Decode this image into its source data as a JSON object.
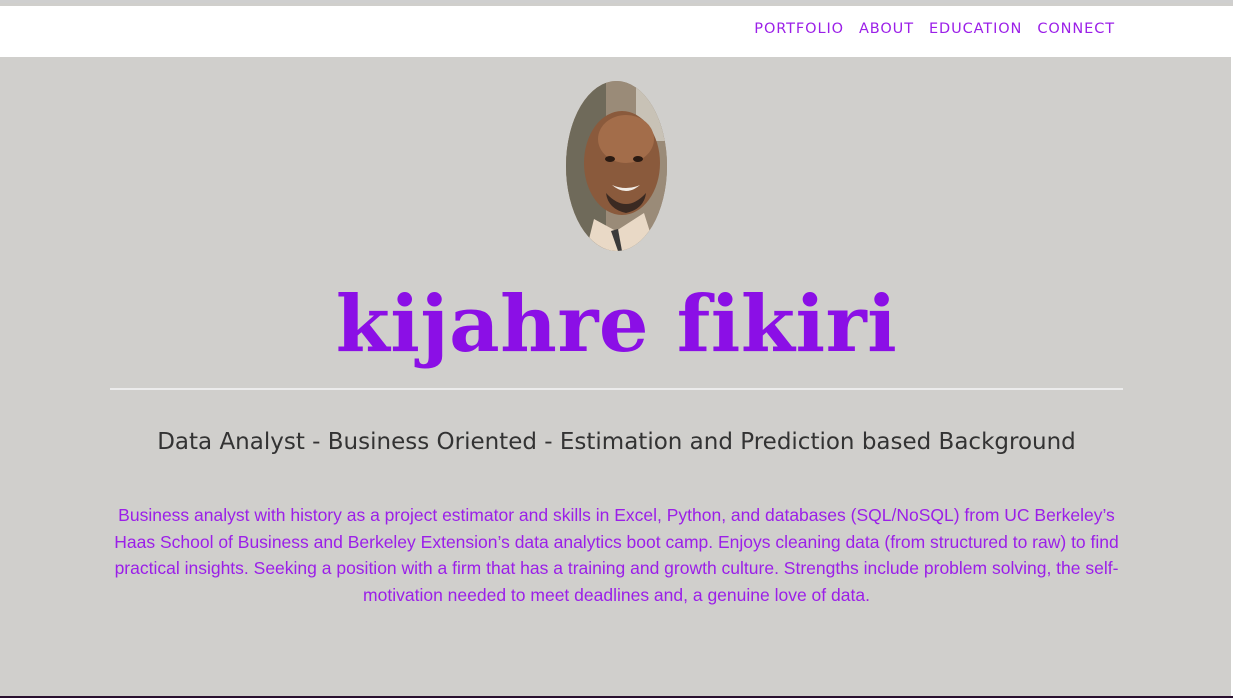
{
  "nav": {
    "items": [
      {
        "label": "PORTFOLIO"
      },
      {
        "label": "ABOUT"
      },
      {
        "label": "EDUCATION"
      },
      {
        "label": "CONNECT"
      }
    ]
  },
  "hero": {
    "name": "kijahre fikiri",
    "tagline": "Data Analyst - Business Oriented - Estimation and Prediction based Background",
    "bio": "Business analyst with history as a project estimator and skills in Excel, Python, and databases (SQL/NoSQL) from UC Berkeley’s Haas School of Business and Berkeley Extension’s data analytics boot camp. Enjoys cleaning data (from structured to raw) to find practical insights. Seeking a position with a firm that has a training and growth culture. Strengths include problem solving, the self-motivation needed to meet deadlines and, a genuine love of data."
  },
  "colors": {
    "accent": "#9b1fe8",
    "background": "#d0cfcc",
    "navbar": "#ffffff",
    "tagline": "#333333"
  },
  "icons": {
    "avatar": "profile-photo"
  }
}
